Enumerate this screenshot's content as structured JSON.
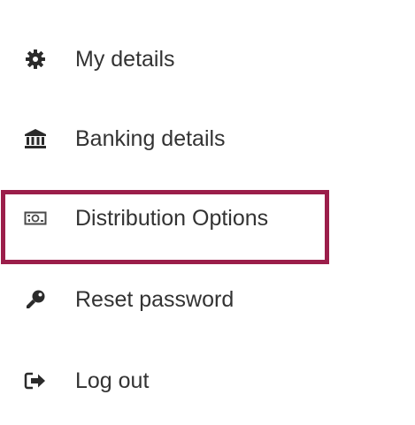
{
  "menu": {
    "items": [
      {
        "label": "My details",
        "icon": "gear-icon"
      },
      {
        "label": "Banking details",
        "icon": "bank-icon"
      },
      {
        "label": "Distribution Options",
        "icon": "money-icon"
      },
      {
        "label": "Reset password",
        "icon": "key-icon"
      },
      {
        "label": "Log out",
        "icon": "sign-out-icon"
      }
    ],
    "highlighted_item": "Distribution Options"
  },
  "colors": {
    "text": "#333333",
    "icon": "#2b2b2b",
    "highlight_border": "#9b1e4a",
    "background": "#ffffff"
  }
}
